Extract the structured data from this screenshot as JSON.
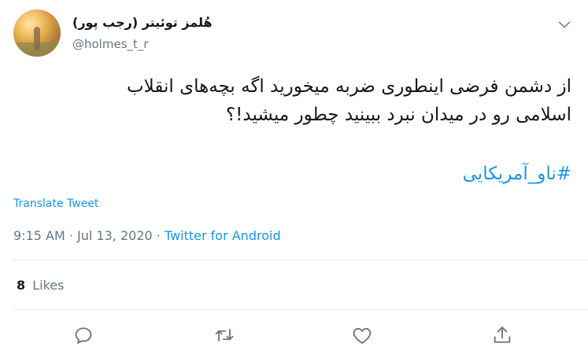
{
  "tweet": {
    "author_name": "هُلمز توئیتر (رجب پور)",
    "handle": "@holmes_t_r",
    "text_line1": "از دشمن فرضی اینطوری ضربه میخورید اگه بچه‌های انقلاب",
    "text_line2": "اسلامی رو در میدان نبرد ببینید چطور میشید!؟",
    "hashtag": "#ناو_آمریکایی",
    "translate_label": "Translate Tweet",
    "time": "9:15 AM",
    "date": "Jul 13, 2020",
    "separator": " · ",
    "source": "Twitter for Android",
    "likes_count": "8",
    "likes_label": "Likes"
  },
  "icons": {
    "caret": "chevron-down-icon",
    "reply": "reply-icon",
    "retweet": "retweet-icon",
    "like": "heart-icon",
    "share": "share-icon"
  },
  "colors": {
    "link": "#1b95e0",
    "secondary_text": "#657786",
    "primary_text": "#14171a",
    "divider": "#e6ecf0"
  }
}
